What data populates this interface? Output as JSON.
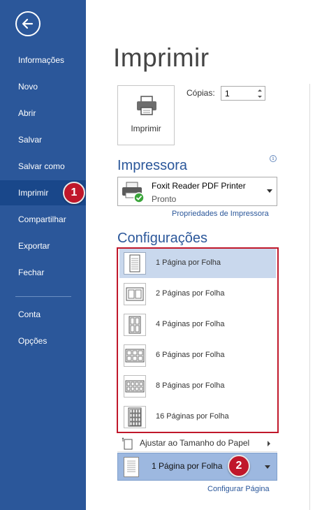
{
  "sidebar": {
    "items": [
      {
        "label": "Informações"
      },
      {
        "label": "Novo"
      },
      {
        "label": "Abrir"
      },
      {
        "label": "Salvar"
      },
      {
        "label": "Salvar como"
      },
      {
        "label": "Imprimir"
      },
      {
        "label": "Compartilhar"
      },
      {
        "label": "Exportar"
      },
      {
        "label": "Fechar"
      },
      {
        "label": "Conta"
      },
      {
        "label": "Opções"
      }
    ],
    "active": "Imprimir",
    "color": "#2b579a"
  },
  "callouts": {
    "one": "1",
    "two": "2",
    "color": "#c0172a"
  },
  "main": {
    "title": "Imprimir",
    "print_button_label": "Imprimir",
    "copies_label": "Cópias:",
    "copies_value": "1"
  },
  "printer": {
    "heading": "Impressora",
    "name": "Foxit Reader PDF Printer",
    "status": "Pronto",
    "properties_link": "Propriedades de Impressora"
  },
  "settings": {
    "heading": "Configurações",
    "pages_per_sheet_options": [
      {
        "label": "1 Página por Folha",
        "grid": [
          1,
          1
        ]
      },
      {
        "label": "2 Páginas por Folha",
        "grid": [
          2,
          1
        ]
      },
      {
        "label": "4 Páginas por Folha",
        "grid": [
          2,
          2
        ]
      },
      {
        "label": "6 Páginas por Folha",
        "grid": [
          3,
          2
        ]
      },
      {
        "label": "8 Páginas por Folha",
        "grid": [
          4,
          2
        ]
      },
      {
        "label": "16 Páginas por Folha",
        "grid": [
          4,
          4
        ]
      }
    ],
    "selected_option": "1 Página por Folha",
    "fit_label": "Ajustar ao Tamanho do Papel",
    "current_value": "1 Página por Folha",
    "page_setup_link": "Configurar Página"
  }
}
